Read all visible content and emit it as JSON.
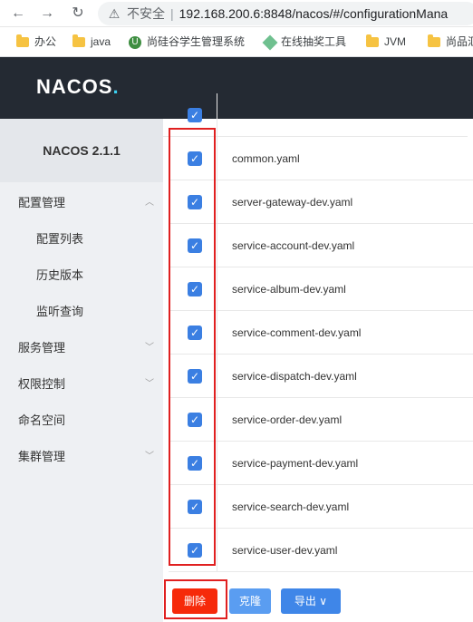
{
  "browser": {
    "insecure_label": "不安全",
    "url": "192.168.200.6:8848/nacos/#/configurationMana"
  },
  "bookmarks": [
    {
      "label": "办公",
      "icon": "folder-icon"
    },
    {
      "label": "java",
      "icon": "folder-icon"
    },
    {
      "label": "尚硅谷学生管理系统",
      "icon": "shield-icon"
    },
    {
      "label": "在线抽奖工具",
      "icon": "diamond-icon"
    },
    {
      "label": "JVM",
      "icon": "folder-icon"
    },
    {
      "label": "尚品汇",
      "icon": "folder-icon"
    }
  ],
  "header": {
    "logo": "NACOS"
  },
  "sidebar": {
    "version": "NACOS 2.1.1",
    "items": [
      {
        "label": "配置管理"
      },
      {
        "label": "配置列表"
      },
      {
        "label": "历史版本"
      },
      {
        "label": "监听查询"
      },
      {
        "label": "服务管理"
      },
      {
        "label": "权限控制"
      },
      {
        "label": "命名空间"
      },
      {
        "label": "集群管理"
      }
    ]
  },
  "table": {
    "rows": [
      {
        "name": "common.yaml",
        "checked": true
      },
      {
        "name": "server-gateway-dev.yaml",
        "checked": true
      },
      {
        "name": "service-account-dev.yaml",
        "checked": true
      },
      {
        "name": "service-album-dev.yaml",
        "checked": true
      },
      {
        "name": "service-comment-dev.yaml",
        "checked": true
      },
      {
        "name": "service-dispatch-dev.yaml",
        "checked": true
      },
      {
        "name": "service-order-dev.yaml",
        "checked": true
      },
      {
        "name": "service-payment-dev.yaml",
        "checked": true
      },
      {
        "name": "service-search-dev.yaml",
        "checked": true
      },
      {
        "name": "service-user-dev.yaml",
        "checked": true
      }
    ]
  },
  "actions": {
    "delete": "删除",
    "clone": "克隆",
    "export": "导出"
  },
  "colors": {
    "header_bg": "#242a33",
    "checkbox": "#3b7fe2",
    "delete_button": "#f62a0a",
    "highlight": "#e02020"
  }
}
